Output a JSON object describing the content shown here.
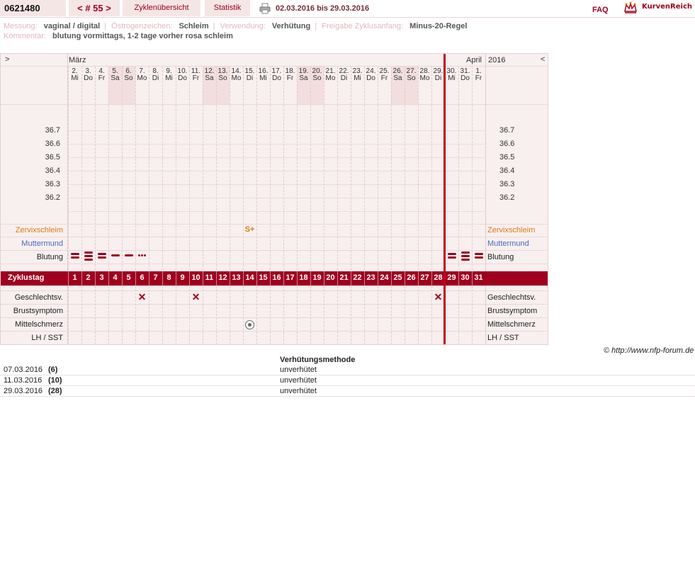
{
  "header": {
    "user_id": "0621480",
    "cycle_nav": "< # 55 >",
    "tab_overview": "Zyklenübersicht",
    "tab_statistics": "Statistik",
    "date_range": "02.03.2016 bis 29.03.2016",
    "faq": "FAQ",
    "logo_text": "KurvenReich"
  },
  "info": {
    "messung_label": "Messung:",
    "messung_value": "vaginal / digital",
    "oestrogen_label": "Östrogenzeichen:",
    "oestrogen_value": "Schleim",
    "verwendung_label": "Verwendung:",
    "verwendung_value": "Verhütung",
    "freigabe_label": "Freigabe Zyklusanfang:",
    "freigabe_value": "Minus-20-Regel",
    "kommentar_label": "Kommentar:",
    "kommentar_value": "blutung vormittags, 1-2 tage vorher rosa schleim"
  },
  "chart": {
    "nav_left": ">",
    "nav_right": "<",
    "month_1": "März",
    "month_2": "April",
    "year": "2016",
    "days": [
      {
        "d": "2.",
        "w": "Mi"
      },
      {
        "d": "3.",
        "w": "Do"
      },
      {
        "d": "4.",
        "w": "Fr"
      },
      {
        "d": "5.",
        "w": "Sa"
      },
      {
        "d": "6.",
        "w": "So"
      },
      {
        "d": "7.",
        "w": "Mo"
      },
      {
        "d": "8.",
        "w": "Di"
      },
      {
        "d": "9.",
        "w": "Mi"
      },
      {
        "d": "10.",
        "w": "Do"
      },
      {
        "d": "11.",
        "w": "Fr"
      },
      {
        "d": "12.",
        "w": "Sa"
      },
      {
        "d": "13.",
        "w": "So"
      },
      {
        "d": "14.",
        "w": "Mo"
      },
      {
        "d": "15.",
        "w": "Di"
      },
      {
        "d": "16.",
        "w": "Mi"
      },
      {
        "d": "17.",
        "w": "Do"
      },
      {
        "d": "18.",
        "w": "Fr"
      },
      {
        "d": "19.",
        "w": "Sa"
      },
      {
        "d": "20.",
        "w": "So"
      },
      {
        "d": "21.",
        "w": "Mo"
      },
      {
        "d": "22.",
        "w": "Di"
      },
      {
        "d": "23.",
        "w": "Mi"
      },
      {
        "d": "24.",
        "w": "Do"
      },
      {
        "d": "25.",
        "w": "Fr"
      },
      {
        "d": "26.",
        "w": "Sa"
      },
      {
        "d": "27.",
        "w": "So"
      },
      {
        "d": "28.",
        "w": "Mo"
      },
      {
        "d": "29.",
        "w": "Di"
      },
      {
        "d": "30.",
        "w": "Mi"
      },
      {
        "d": "31.",
        "w": "Do"
      },
      {
        "d": "1.",
        "w": "Fr"
      }
    ],
    "temperature_ticks": [
      "36.7",
      "36.6",
      "36.5",
      "36.4",
      "36.3",
      "36.2"
    ],
    "row_labels": {
      "zervix": "Zervixschleim",
      "muttermund": "Muttermund",
      "blutung": "Blutung",
      "zyklustag": "Zyklustag",
      "gv": "Geschlechtsv.",
      "brust": "Brustsymptom",
      "mittelschmerz": "Mittelschmerz",
      "lh": "LH / SST"
    },
    "cycle_days": [
      "1",
      "2",
      "3",
      "4",
      "5",
      "6",
      "7",
      "8",
      "9",
      "10",
      "11",
      "12",
      "13",
      "14",
      "15",
      "16",
      "17",
      "18",
      "19",
      "20",
      "21",
      "22",
      "23",
      "24",
      "25",
      "26",
      "27",
      "28",
      "29",
      "30",
      "31"
    ],
    "zervix_symbol": {
      "day": 14,
      "symbol": "S+"
    },
    "bleeding": [
      {
        "day": 1,
        "level": "heavy"
      },
      {
        "day": 2,
        "level": "very-heavy"
      },
      {
        "day": 3,
        "level": "heavy"
      },
      {
        "day": 4,
        "level": "medium"
      },
      {
        "day": 5,
        "level": "medium"
      },
      {
        "day": 6,
        "level": "spotting"
      },
      {
        "day": 29,
        "level": "heavy"
      },
      {
        "day": 30,
        "level": "very-heavy"
      },
      {
        "day": 31,
        "level": "heavy"
      }
    ],
    "intercourse_days": [
      6,
      10,
      28
    ],
    "mittelschmerz_days": [
      14
    ],
    "accent_color": "#a0001e",
    "zervix_color": "#e07a10",
    "muttermund_color": "#4a6ac0"
  },
  "copyright": "© http://www.nfp-forum.de",
  "method_table": {
    "header": "Verhütungsmethode",
    "rows": [
      {
        "date": "07.03.2016",
        "cycle_day": "(6)",
        "method": "unverhütet"
      },
      {
        "date": "11.03.2016",
        "cycle_day": "(10)",
        "method": "unverhütet"
      },
      {
        "date": "29.03.2016",
        "cycle_day": "(28)",
        "method": "unverhütet"
      }
    ]
  }
}
